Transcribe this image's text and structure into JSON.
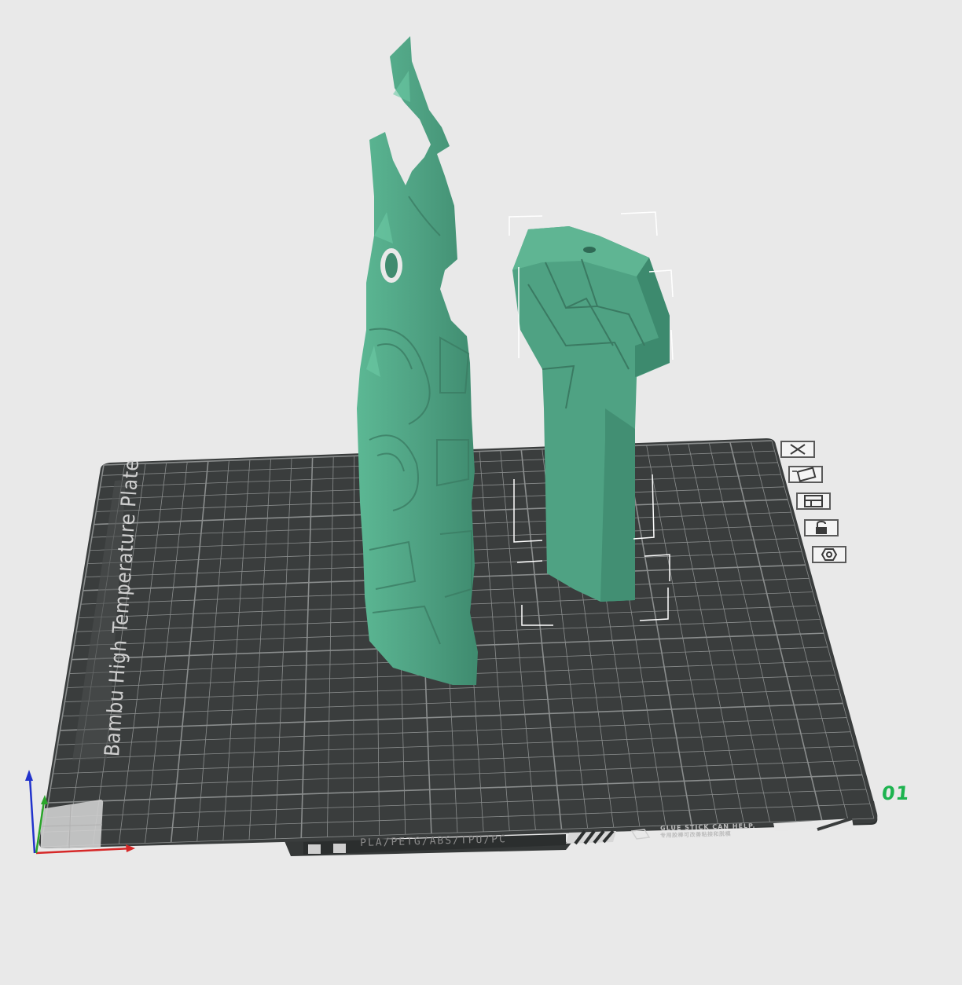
{
  "viewport": {
    "background": "#e9e9e9",
    "model_color": "#4fa283"
  },
  "build_plate": {
    "name": "Bambu High Temperature Plate",
    "plate_number": "01",
    "filament_types": "PLA/PETG/ABS/TPU/PC",
    "glue_note_en": "GLUE STICK CAN HELP.",
    "glue_note_cn": "专用胶棒可改善粘接和脱模",
    "surface_color": "#3a3d3d",
    "grid_color": "#8a8d8d",
    "number_color": "#1db34f"
  },
  "plate_toolbar": [
    {
      "name": "remove-plate-icon"
    },
    {
      "name": "auto-arrange-icon"
    },
    {
      "name": "plate-layout-icon"
    },
    {
      "name": "lock-plate-icon"
    },
    {
      "name": "plate-settings-icon"
    }
  ],
  "axes": {
    "x_color": "#d62828",
    "y_color": "#2aa52a",
    "z_color": "#2233cc"
  }
}
